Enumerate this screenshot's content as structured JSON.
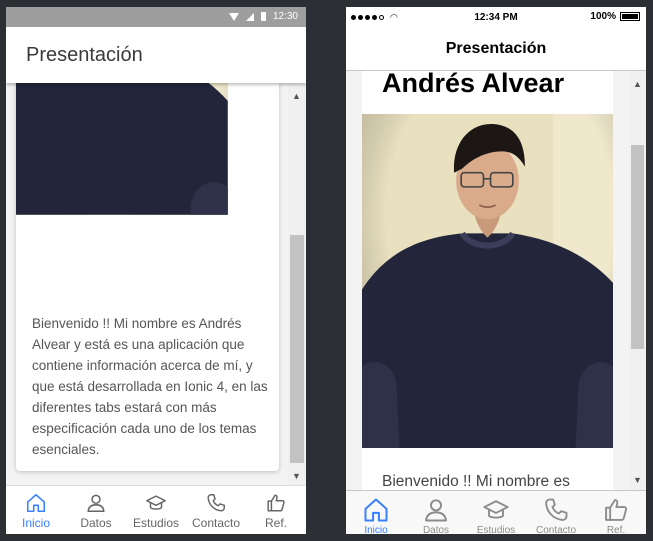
{
  "android": {
    "status_time": "12:30",
    "title": "Presentación",
    "text": "Bienvenido !! Mi nombre es Andrés Alvear y está es una aplicación que contiene información acerca de mí, y que está desarrollada en Ionic 4, en las diferentes tabs estará con más especificación cada uno de los temas esenciales.",
    "tabs": [
      {
        "label": "Inicio",
        "icon": "home-icon"
      },
      {
        "label": "Datos",
        "icon": "person-icon"
      },
      {
        "label": "Estudios",
        "icon": "school-icon"
      },
      {
        "label": "Contacto",
        "icon": "phone-icon"
      },
      {
        "label": "Ref.",
        "icon": "thumbs-up-icon"
      }
    ]
  },
  "ios": {
    "status_time": "12:34 PM",
    "battery": "100%",
    "title": "Presentación",
    "name": "Andrés Alvear",
    "text": "Bienvenido !! Mi nombre es",
    "tabs": [
      {
        "label": "Inicio",
        "icon": "home-icon"
      },
      {
        "label": "Datos",
        "icon": "person-icon"
      },
      {
        "label": "Estudios",
        "icon": "school-icon"
      },
      {
        "label": "Contacto",
        "icon": "phone-icon"
      },
      {
        "label": "Ref.",
        "icon": "thumbs-up-icon"
      }
    ]
  },
  "colors": {
    "accent": "#3880ff",
    "status_bar_android": "#9e9e9e",
    "photo_bg": "#e8e0bf",
    "sweater": "#23263a"
  }
}
